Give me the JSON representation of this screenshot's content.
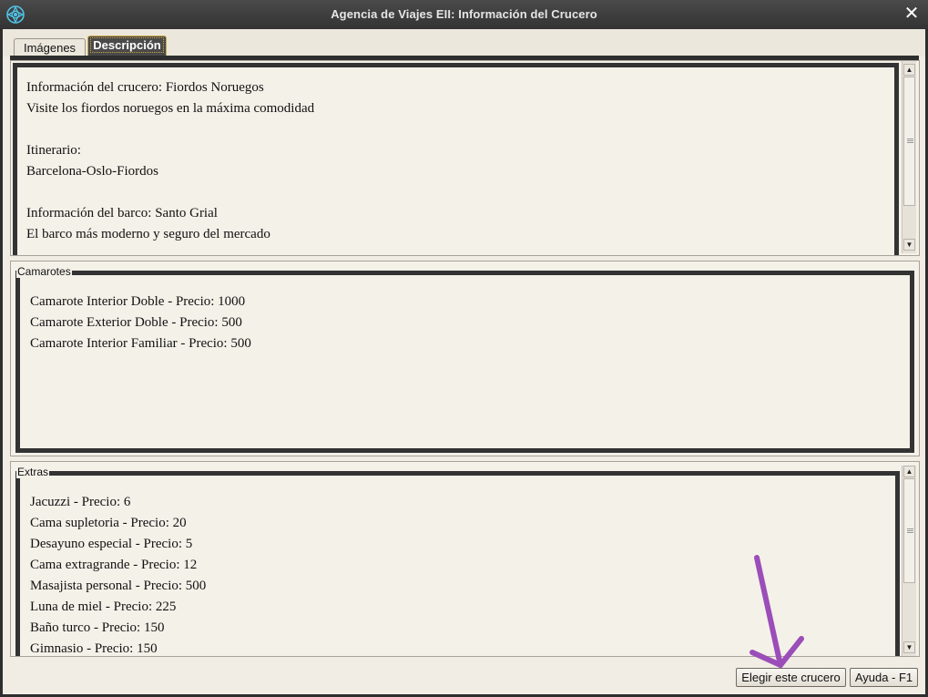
{
  "window": {
    "title": "Agencia de Viajes EII: Información del Crucero"
  },
  "tabs": [
    {
      "label": "Imágenes",
      "active": false
    },
    {
      "label": "Descripción",
      "active": true
    }
  ],
  "description": {
    "lines": [
      "Información del crucero: Fiordos Noruegos",
      "Visite los fiordos noruegos en la máxima comodidad",
      "",
      "Itinerario:",
      "Barcelona-Oslo-Fiordos",
      "",
      "Información del barco:  Santo Grial",
      "El barco más moderno y seguro del mercado"
    ]
  },
  "cabins": {
    "legend": "Camarotes",
    "items": [
      "Camarote Interior Doble - Precio: 1000",
      "Camarote Exterior Doble - Precio: 500",
      "Camarote Interior Familiar - Precio: 500"
    ]
  },
  "extras": {
    "legend": "Extras",
    "items": [
      "Jacuzzi - Precio: 6",
      "Cama supletoria - Precio: 20",
      "Desayuno especial - Precio: 5",
      "Cama extragrande - Precio: 12",
      "Masajista personal - Precio: 500",
      "Luna de miel - Precio: 225",
      "Baño turco - Precio: 150",
      "Gimnasio - Precio: 150"
    ]
  },
  "buttons": {
    "choose": "Elegir este crucero",
    "help": "Ayuda - F1"
  },
  "colors": {
    "annotation_arrow": "#9b4db8",
    "title_bar": "#3b3b3b",
    "panel_background": "#f4f1e9"
  }
}
